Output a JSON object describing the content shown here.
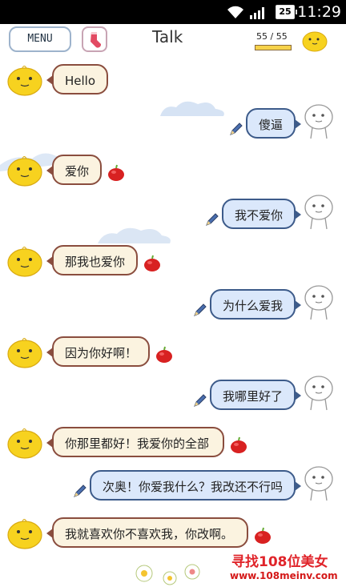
{
  "status_bar": {
    "time": "11:29",
    "battery": "25"
  },
  "header": {
    "menu_label": "MENU",
    "title": "Talk",
    "counter": "55 / 55",
    "counter_level": 1.0
  },
  "messages": [
    {
      "side": "left",
      "text": "Hello"
    },
    {
      "side": "right",
      "text": "傻逼"
    },
    {
      "side": "left",
      "text": "爱你"
    },
    {
      "side": "right",
      "text": "我不爱你"
    },
    {
      "side": "left",
      "text": "那我也爱你"
    },
    {
      "side": "right",
      "text": "为什么爱我"
    },
    {
      "side": "left",
      "text": "因为你好啊！"
    },
    {
      "side": "right",
      "text": "我哪里好了"
    },
    {
      "side": "left",
      "text": "你那里都好！我爱你的全部"
    },
    {
      "side": "right",
      "text": "次奥！你爱我什么？我改还不行吗"
    },
    {
      "side": "left",
      "text": "我就喜欢你不喜欢我，你改啊。"
    }
  ],
  "watermark": {
    "title": "寻找108位美女",
    "url": "www.108meinv.com"
  },
  "colors": {
    "left_bubble": "#fbf3e0",
    "left_border": "#8a4d3e",
    "right_bubble": "#dbe8fb",
    "right_border": "#3d5b8a",
    "chick": "#f7d21f"
  }
}
